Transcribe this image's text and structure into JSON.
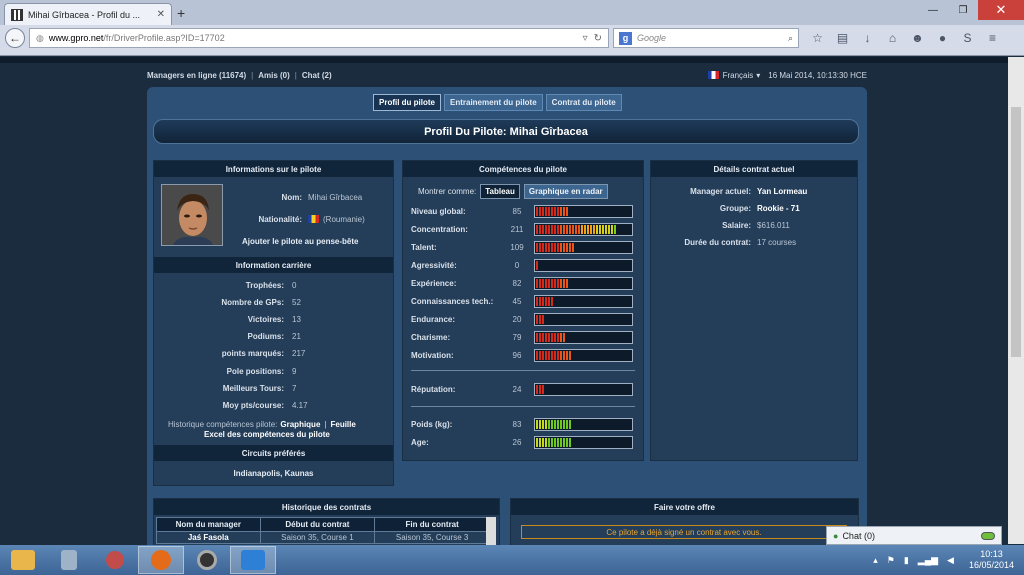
{
  "browser": {
    "tab_title": "Mihai Gîrbacea - Profil du ...",
    "url_host": "www.gpro.net",
    "url_path": "/fr/DriverProfile.asp?ID=17702",
    "search_engine": "g",
    "search_placeholder": "Google"
  },
  "topbar": {
    "managers_online": "Managers en ligne (11674)",
    "friends": "Amis (0)",
    "chat": "Chat (2)",
    "language": "Français",
    "datetime": "16 Mai 2014, 10:13:30 HCE"
  },
  "tabs": [
    {
      "label": "Profil du pilote",
      "active": true
    },
    {
      "label": "Entrainement du pilote",
      "active": false
    },
    {
      "label": "Contrat du pilote",
      "active": false
    }
  ],
  "page_title": "Profil Du Pilote: Mihai Gîrbacea",
  "driver_info": {
    "header": "Informations sur le pilote",
    "name_label": "Nom:",
    "name": "Mihai Gîrbacea",
    "nationality_label": "Nationalité:",
    "nationality": "(Roumanie)",
    "watchlist_link": "Ajouter le pilote au pense-bête"
  },
  "career": {
    "header": "Information carrière",
    "rows": [
      {
        "label": "Trophées:",
        "value": "0"
      },
      {
        "label": "Nombre de GPs:",
        "value": "52"
      },
      {
        "label": "Victoires:",
        "value": "13"
      },
      {
        "label": "Podiums:",
        "value": "21"
      },
      {
        "label": "points marqués:",
        "value": "217"
      },
      {
        "label": "Pole positions:",
        "value": "9"
      },
      {
        "label": "Meilleurs Tours:",
        "value": "7"
      },
      {
        "label": "Moy pts/course:",
        "value": "4.17"
      }
    ],
    "history_text": "Historique compétences pilote:",
    "history_link1": "Graphique",
    "history_sep": "|",
    "history_link2": "Feuille",
    "history_link3": "Excel des compétences du pilote"
  },
  "circuits": {
    "header": "Circuits préférés",
    "value": "Indianapolis, Kaunas"
  },
  "skills": {
    "header": "Compétences du pilote",
    "show_as": "Montrer comme:",
    "btn_table": "Tableau",
    "btn_radar": "Graphique en radar",
    "rows": [
      {
        "label": "Niveau global:",
        "value": "85"
      },
      {
        "label": "Concentration:",
        "value": "211"
      },
      {
        "label": "Talent:",
        "value": "109"
      },
      {
        "label": "Agressivité:",
        "value": "0"
      },
      {
        "label": "Expérience:",
        "value": "82"
      },
      {
        "label": "Connaissances tech.:",
        "value": "45"
      },
      {
        "label": "Endurance:",
        "value": "20"
      },
      {
        "label": "Charisme:",
        "value": "79"
      },
      {
        "label": "Motivation:",
        "value": "96"
      }
    ],
    "reputation": {
      "label": "Réputation:",
      "value": "24"
    },
    "weight": {
      "label": "Poids (kg):",
      "value": "83"
    },
    "age": {
      "label": "Age:",
      "value": "26"
    }
  },
  "bar_levels": {
    "niveau": 0.34,
    "concentration": 0.84,
    "talent": 0.42,
    "agressivite": 0.03,
    "experience": 0.34,
    "connaissances": 0.18,
    "endurance": 0.1,
    "charisme": 0.31,
    "motivation": 0.38,
    "reputation": 0.1,
    "poids": 0.38,
    "age": 0.38
  },
  "contract": {
    "header": "Détails contrat actuel",
    "rows": [
      {
        "label": "Manager actuel:",
        "value": "Yan Lormeau"
      },
      {
        "label": "Groupe:",
        "value": "Rookie - 71"
      },
      {
        "label": "Salaire:",
        "value": "$616.011"
      },
      {
        "label": "Durée du contrat:",
        "value": "17 courses"
      }
    ]
  },
  "history": {
    "header": "Historique des contrats",
    "columns": [
      "Nom du manager",
      "Début du contrat",
      "Fin du contrat"
    ],
    "rows": [
      [
        "Jaś Fasola",
        "Saison 35, Course 1",
        "Saison 35, Course 3"
      ]
    ]
  },
  "offer": {
    "header": "Faire votre offre",
    "notice": "Ce pilote a déjà signé un contrat avec vous."
  },
  "chat_widget": {
    "label": "Chat (0)"
  },
  "taskbar": {
    "time": "10:13",
    "date": "16/05/2014"
  }
}
